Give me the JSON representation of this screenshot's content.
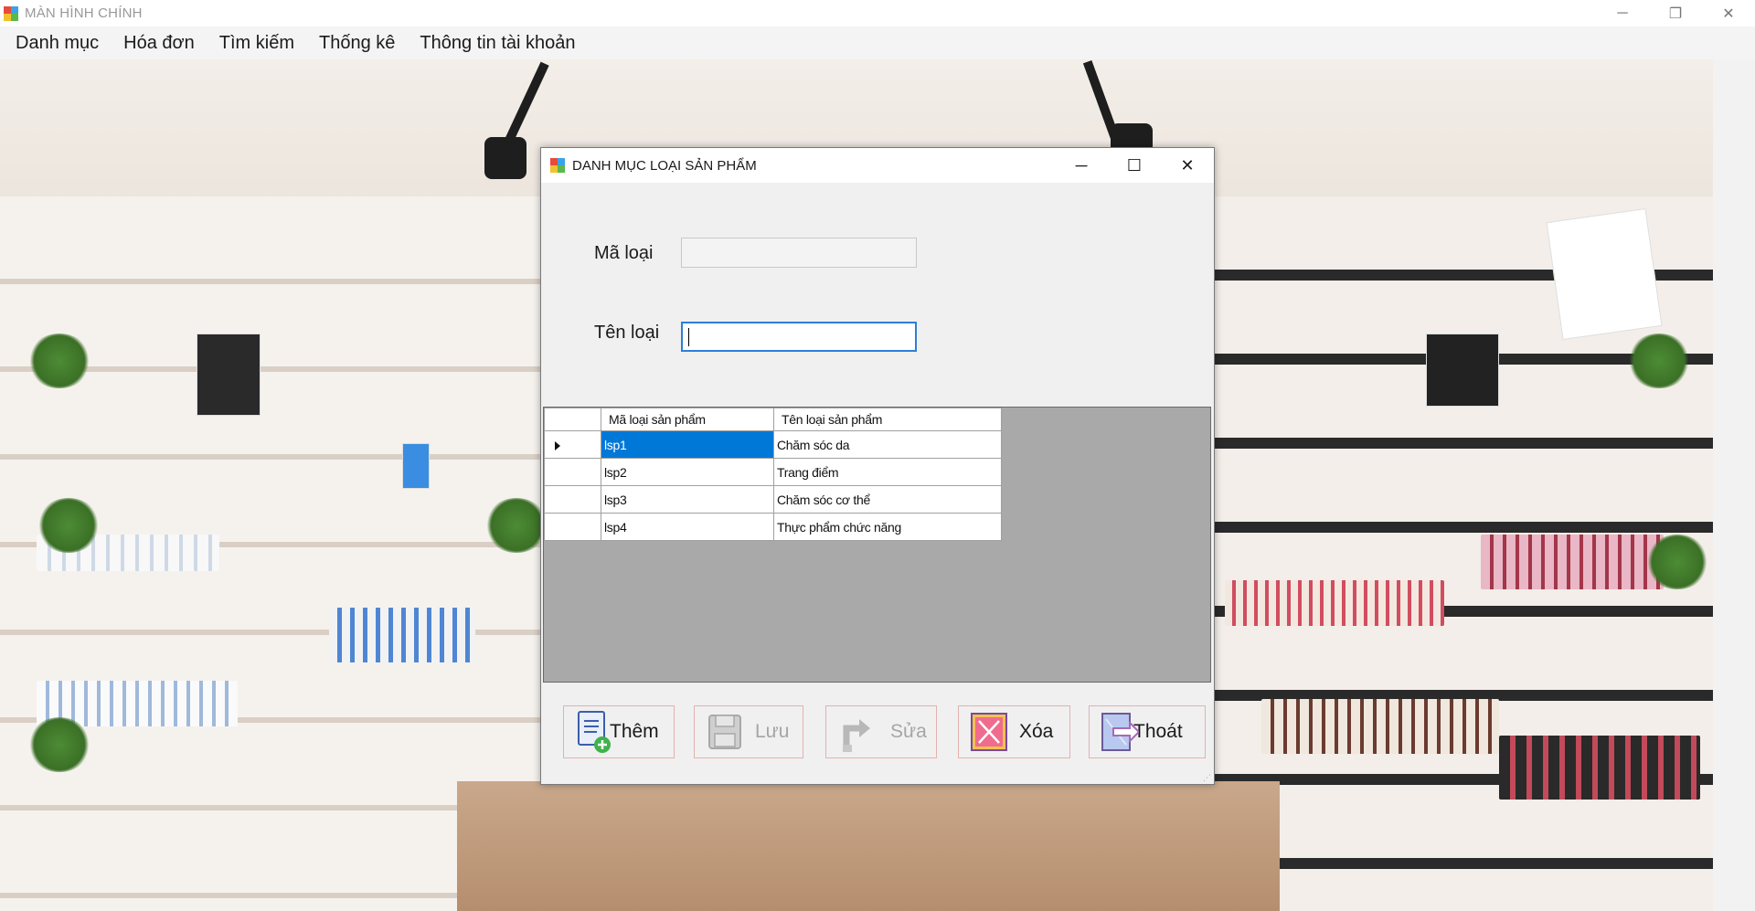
{
  "main_window": {
    "title": "MÀN HÌNH CHÍNH",
    "controls": {
      "minimize": "─",
      "restore": "❐",
      "close": "✕"
    }
  },
  "menu": {
    "items": [
      "Danh mục",
      "Hóa đơn",
      "Tìm kiếm",
      "Thống kê",
      "Thông tin tài khoản"
    ]
  },
  "dialog": {
    "title": "DANH MỤC LOẠI SẢN PHẨM",
    "controls": {
      "minimize": "─",
      "maximize": "☐",
      "close": "✕"
    },
    "form": {
      "ma_loai_label": "Mã loại",
      "ma_loai_value": "",
      "ten_loai_label": "Tên loại",
      "ten_loai_value": ""
    },
    "grid": {
      "columns": [
        "Mã loại sản phẩm",
        "Tên loại sản phẩm"
      ],
      "rows": [
        {
          "ma": "lsp1",
          "ten": "Chăm sóc da",
          "selected": true
        },
        {
          "ma": "lsp2",
          "ten": "Trang điểm",
          "selected": false
        },
        {
          "ma": "lsp3",
          "ten": "Chăm sóc cơ thể",
          "selected": false
        },
        {
          "ma": "lsp4",
          "ten": "Thực phẩm chức năng",
          "selected": false
        }
      ]
    },
    "buttons": {
      "them": "Thêm",
      "luu": "Lưu",
      "sua": "Sửa",
      "xoa": "Xóa",
      "thoat": "Thoát"
    }
  },
  "colors": {
    "selection": "#0078d7",
    "focus_border": "#2d7fd6",
    "button_border": "#e4b1b1"
  }
}
